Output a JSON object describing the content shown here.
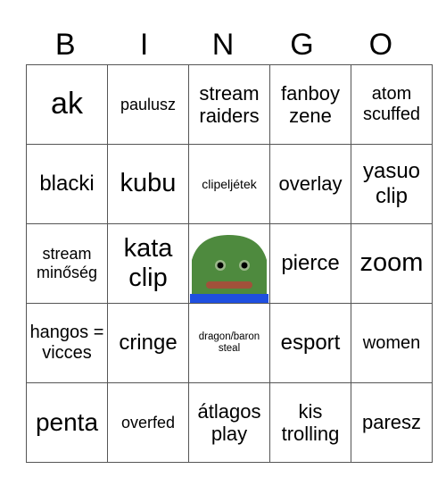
{
  "header": [
    "B",
    "I",
    "N",
    "G",
    "O"
  ],
  "cells": [
    [
      "ak",
      "paulusz",
      "stream raiders",
      "fanboy zene",
      "atom scuffed"
    ],
    [
      "blacki",
      "kubu",
      "clipeljétek",
      "overlay",
      "yasuo clip"
    ],
    [
      "stream minőség",
      "kata clip",
      "",
      "pierce",
      "zoom"
    ],
    [
      "hangos = vicces",
      "cringe",
      "dragon/baron steal",
      "esport",
      "women"
    ],
    [
      "penta",
      "overfed",
      "átlagos play",
      "kis trolling",
      "paresz"
    ]
  ],
  "free_space": {
    "icon": "pepe-frog-icon",
    "colors": {
      "skin": "#4e8a3e",
      "mouth": "#a1513a",
      "shirt": "#1f4fe0"
    }
  }
}
